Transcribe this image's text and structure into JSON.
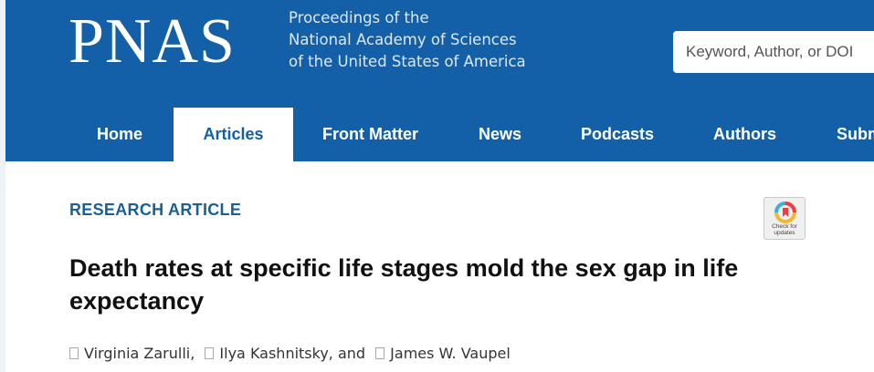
{
  "header": {
    "logo": "PNAS",
    "tagline": [
      "Proceedings of the",
      "National Academy of Sciences",
      "of the United States of America"
    ],
    "search_placeholder": "Keyword, Author, or DOI"
  },
  "nav": {
    "items": [
      {
        "label": "Home"
      },
      {
        "label": "Articles"
      },
      {
        "label": "Front Matter"
      },
      {
        "label": "News"
      },
      {
        "label": "Podcasts"
      },
      {
        "label": "Authors"
      },
      {
        "label": "Subm"
      }
    ],
    "active": "Articles"
  },
  "article": {
    "type": "RESEARCH ARTICLE",
    "title": "Death rates at specific life stages mold the sex gap in life expectancy",
    "authors": [
      {
        "name": "Virginia Zarulli",
        "sep": ","
      },
      {
        "name": "Ilya Kashnitsky",
        "sep": ", and"
      },
      {
        "name": "James W. Vaupel",
        "sep": ""
      }
    ],
    "check_updates": [
      "Check for",
      "updates"
    ]
  },
  "colors": {
    "header_bg": "#1460a8",
    "article_type": "#1b5f97"
  }
}
